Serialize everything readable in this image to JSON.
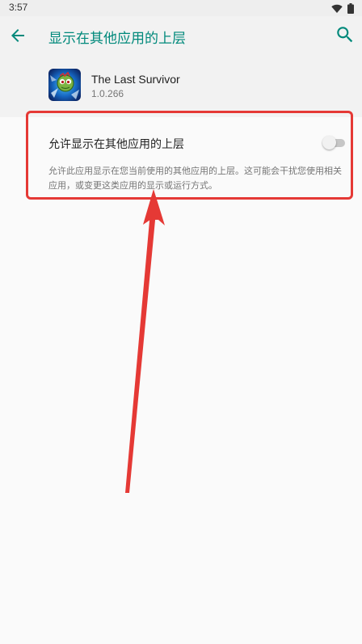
{
  "status_bar": {
    "time": "3:57"
  },
  "toolbar": {
    "back_icon": "arrow-left-icon",
    "title": "显示在其他应用的上层",
    "search_icon": "search-icon"
  },
  "app": {
    "name": "The Last Survivor",
    "version": "1.0.266"
  },
  "permission": {
    "label": "允许显示在其他应用的上层",
    "enabled": false,
    "description": "允许此应用显示在您当前使用的其他应用的上层。这可能会干扰您使用相关应用，或变更这类应用的显示或运行方式。"
  },
  "colors": {
    "accent": "#00897b",
    "annotation": "#e53935"
  }
}
